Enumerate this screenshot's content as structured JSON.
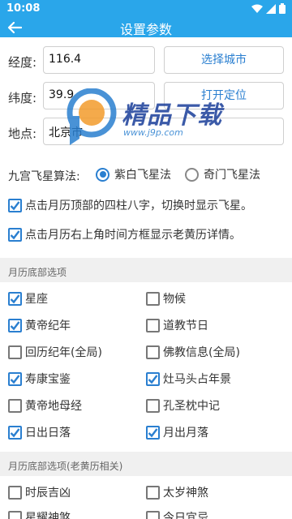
{
  "status_bar": {
    "time": "10:08"
  },
  "toolbar": {
    "title": "设置参数"
  },
  "form": {
    "longitude_label": "经度:",
    "longitude_value": "116.4",
    "latitude_label": "纬度:",
    "latitude_value": "39.9",
    "location_label": "地点:",
    "location_value": "北京市",
    "choose_city_button": "选择城市",
    "locate_button": "打开定位"
  },
  "algorithm": {
    "label": "九宫飞星算法:",
    "options": [
      {
        "label": "紫白飞星法",
        "selected": true
      },
      {
        "label": "奇门飞星法",
        "selected": false
      }
    ]
  },
  "options": [
    {
      "label": "点击月历顶部的四柱八字，切换时显示飞星。",
      "checked": true
    },
    {
      "label": "点击月历右上角时间方框显示老黄历详情。",
      "checked": true
    }
  ],
  "section1": {
    "title": "月历底部选项",
    "items": [
      {
        "label": "星座",
        "checked": true
      },
      {
        "label": "物候",
        "checked": false
      },
      {
        "label": "黄帝纪年",
        "checked": true
      },
      {
        "label": "道教节日",
        "checked": false
      },
      {
        "label": "回历纪年(全局)",
        "checked": false
      },
      {
        "label": "佛教信息(全局)",
        "checked": false
      },
      {
        "label": "寿康宝鉴",
        "checked": true
      },
      {
        "label": "灶马头占年景",
        "checked": true
      },
      {
        "label": "黄帝地母经",
        "checked": false
      },
      {
        "label": "孔圣枕中记",
        "checked": false
      },
      {
        "label": "日出日落",
        "checked": true
      },
      {
        "label": "月出月落",
        "checked": true
      }
    ]
  },
  "section2": {
    "title": "月历底部选项(老黄历相关)",
    "items": [
      {
        "label": "时辰吉凶",
        "checked": false
      },
      {
        "label": "太岁神煞",
        "checked": false
      },
      {
        "label": "星耀神煞",
        "checked": false
      },
      {
        "label": "今日宜忌",
        "checked": false
      }
    ]
  },
  "watermark": {
    "title": "精品下载",
    "url": "www.j9p.com"
  },
  "colors": {
    "accent": "#2aa6ea",
    "check": "#2a7fd0"
  }
}
